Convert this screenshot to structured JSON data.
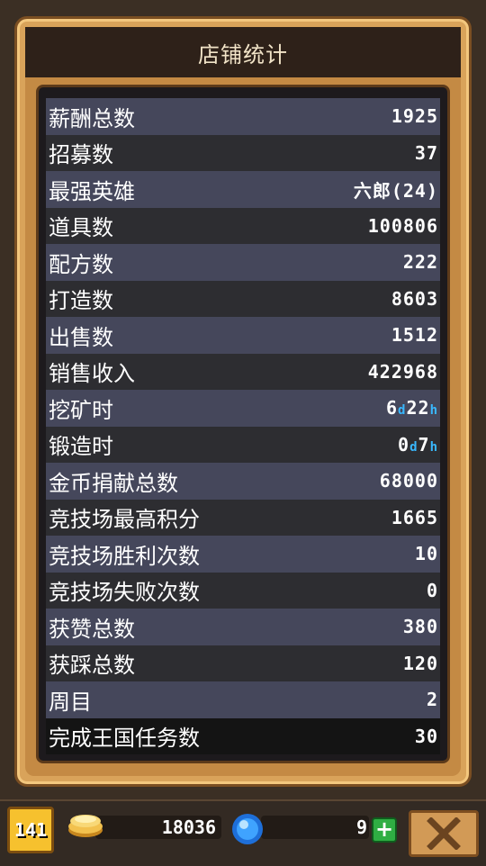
{
  "title": "店铺统计",
  "stats": [
    {
      "label": "薪酬总数",
      "value": "1925"
    },
    {
      "label": "招募数",
      "value": "37"
    },
    {
      "label": "最强英雄",
      "value": "六郎(24)"
    },
    {
      "label": "道具数",
      "value": "100806"
    },
    {
      "label": "配方数",
      "value": "222"
    },
    {
      "label": "打造数",
      "value": "8603"
    },
    {
      "label": "出售数",
      "value": "1512"
    },
    {
      "label": "销售收入",
      "value": "422968"
    },
    {
      "label": "挖矿时",
      "value": "6",
      "unit_d": "d",
      "value2": "22",
      "unit_h": "h"
    },
    {
      "label": "锻造时",
      "value": "0",
      "unit_d": "d",
      "value2": "7",
      "unit_h": "h"
    },
    {
      "label": "金币捐献总数",
      "value": "68000"
    },
    {
      "label": "竞技场最高积分",
      "value": "1665"
    },
    {
      "label": "竞技场胜利次数",
      "value": "10"
    },
    {
      "label": "竞技场失败次数",
      "value": "0"
    },
    {
      "label": "获赞总数",
      "value": "380"
    },
    {
      "label": "获踩总数",
      "value": "120"
    },
    {
      "label": "周目",
      "value": "2"
    },
    {
      "label": "完成王国任务数",
      "value": "30"
    }
  ],
  "footer": {
    "level": "141",
    "gold": "18036",
    "gems": "9",
    "plus_label": "+",
    "icons": {
      "gold": "gold-coins-icon",
      "gem": "blue-gem-icon",
      "close": "close-x-icon"
    }
  },
  "colors": {
    "frame": "#d9a35a",
    "row_odd": "#45475b",
    "row_even": "#2d2d31",
    "time_unit": "#39b8ff",
    "plus": "#2fae43"
  }
}
